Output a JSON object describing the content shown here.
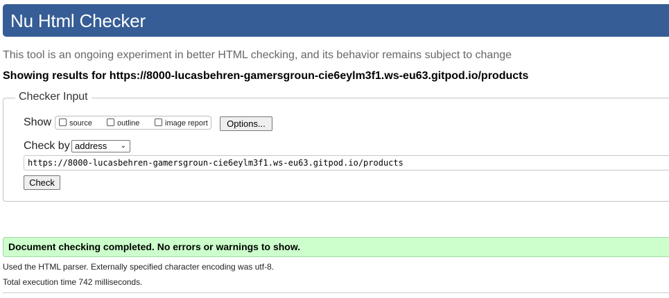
{
  "header": {
    "title": "Nu Html Checker"
  },
  "tagline": "This tool is an ongoing experiment in better HTML checking, and its behavior remains subject to change",
  "showing_results": "Showing results for https://8000-lucasbehren-gamersgroun-cie6eylm3f1.ws-eu63.gitpod.io/products",
  "checker_input": {
    "legend": "Checker Input",
    "show_label": "Show",
    "show_options": [
      {
        "label": "source",
        "checked": false
      },
      {
        "label": "outline",
        "checked": false
      },
      {
        "label": "image report",
        "checked": false
      }
    ],
    "options_button": "Options...",
    "check_by_label": "Check by",
    "check_by_selected": "address",
    "url_value": "https://8000-lucasbehren-gamersgroun-cie6eylm3f1.ws-eu63.gitpod.io/products",
    "check_button": "Check"
  },
  "results": {
    "success_message": "Document checking completed. No errors or warnings to show.",
    "parser_info": "Used the HTML parser. Externally specified character encoding was utf-8.",
    "execution_time": "Total execution time 742 milliseconds."
  },
  "colors": {
    "header_bg": "#365d95",
    "success_bg": "#ccffcc"
  }
}
